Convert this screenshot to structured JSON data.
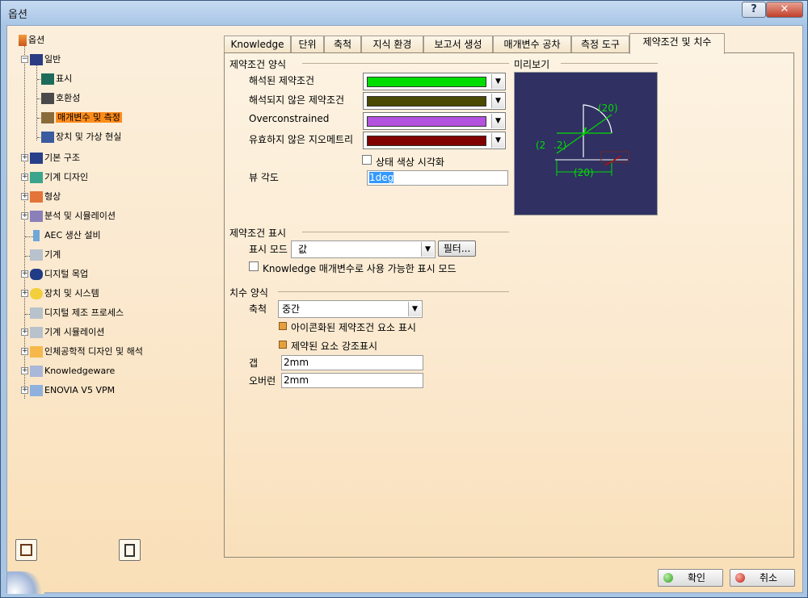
{
  "window": {
    "title": "옵션",
    "help": "?",
    "close": "✕"
  },
  "tree": [
    {
      "label": "옵션",
      "level": 0
    },
    {
      "label": "일반",
      "level": 1
    },
    {
      "label": "표시",
      "level": 2
    },
    {
      "label": "호환성",
      "level": 2
    },
    {
      "label": "매개변수 및 측정",
      "level": 2,
      "selected": true
    },
    {
      "label": "장치 및 가상 현실",
      "level": 2
    },
    {
      "label": "기본 구조",
      "level": 1
    },
    {
      "label": "기계 디자인",
      "level": 1
    },
    {
      "label": "형상",
      "level": 1
    },
    {
      "label": "분석 및 시뮬레이션",
      "level": 1
    },
    {
      "label": "AEC 생산 설비",
      "level": 1
    },
    {
      "label": "기계",
      "level": 1
    },
    {
      "label": "디지털 목업",
      "level": 1
    },
    {
      "label": "장치 및 시스템",
      "level": 1
    },
    {
      "label": "디지털 제조 프로세스",
      "level": 1
    },
    {
      "label": "기계 시뮬레이션",
      "level": 1
    },
    {
      "label": "인체공학적 디자인 및 해석",
      "level": 1
    },
    {
      "label": "Knowledgeware",
      "level": 1
    },
    {
      "label": "ENOVIA V5 VPM",
      "level": 1
    }
  ],
  "tabs": [
    "Knowledge",
    "단위",
    "축척",
    "지식 환경",
    "보고서 생성",
    "매개변수 공차",
    "측정 도구",
    "제약조건 및 치수"
  ],
  "constraint_style": {
    "title": "제약조건 양식",
    "solved_label": "해석된 제약조건",
    "solved_color": "#00dd00",
    "unsolved_label": "해석되지 않은 제약조건",
    "unsolved_color": "#4a4a00",
    "overconstrained_label": "Overconstrained",
    "overconstrained_color": "#b452e0",
    "invalid_label": "유효하지 않은 지오메트리",
    "invalid_color": "#800000",
    "status_color_label": "상태 색상 시각화",
    "view_angle_label": "뷰 각도",
    "view_angle_value": "1deg"
  },
  "preview": {
    "title": "미리보기",
    "labels": [
      "(20)",
      "(2",
      ".2)",
      "(20)"
    ]
  },
  "constraint_display": {
    "title": "제약조건 표시",
    "mode_label": "표시 모드",
    "mode_value": "값",
    "filter_button": "필터...",
    "knowledge_label": "Knowledge 매개변수로 사용 가능한 표시 모드"
  },
  "dimension_style": {
    "title": "치수 양식",
    "scale_label": "축척",
    "scale_value": "중간",
    "iconified_label": "아이콘화된 제약조건 요소 표시",
    "highlight_label": "제약된 요소 강조표시",
    "gap_label": "갭",
    "gap_value": "2mm",
    "overrun_label": "오버런",
    "overrun_value": "2mm"
  },
  "footer": {
    "ok": "확인",
    "cancel": "취소"
  }
}
